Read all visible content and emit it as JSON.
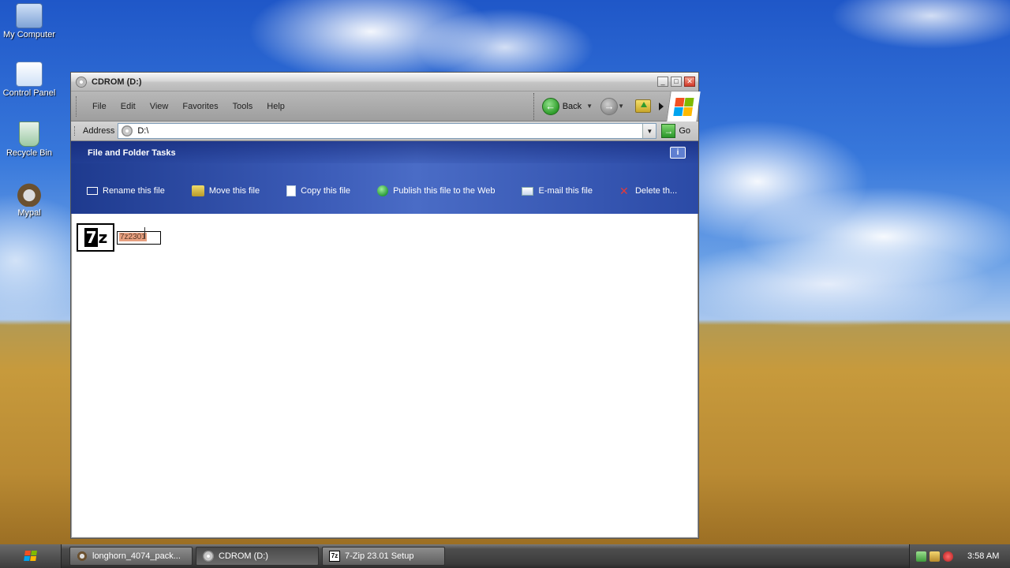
{
  "desktop": {
    "icons": [
      {
        "label": "My Computer"
      },
      {
        "label": "Control Panel"
      },
      {
        "label": "Recycle Bin"
      },
      {
        "label": "Mypal"
      }
    ]
  },
  "window": {
    "title": "CDROM (D:)",
    "menu": [
      "File",
      "Edit",
      "View",
      "Favorites",
      "Tools",
      "Help"
    ],
    "toolbar": {
      "back_label": "Back"
    },
    "address": {
      "label": "Address",
      "value": "D:\\",
      "go_label": "Go"
    },
    "tasks": {
      "header": "File and Folder Tasks",
      "items": [
        {
          "label": "Rename this file"
        },
        {
          "label": "Move this file"
        },
        {
          "label": "Copy this file"
        },
        {
          "label": "Publish this file to the Web"
        },
        {
          "label": "E-mail this file"
        },
        {
          "label": "Delete th..."
        }
      ]
    },
    "file": {
      "icon_text_seven": "7",
      "icon_text_z": "z",
      "rename_value": "7z2301"
    }
  },
  "taskbar": {
    "buttons": [
      {
        "label": "longhorn_4074_pack..."
      },
      {
        "label": "CDROM (D:)"
      },
      {
        "label": "7-Zip 23.01 Setup",
        "icon_text": "7z"
      }
    ],
    "clock": "3:58 AM"
  },
  "colors": {
    "tasks_panel": "#3c5cb8",
    "selection_highlight": "#e8a080",
    "close_button": "#d2392a"
  }
}
